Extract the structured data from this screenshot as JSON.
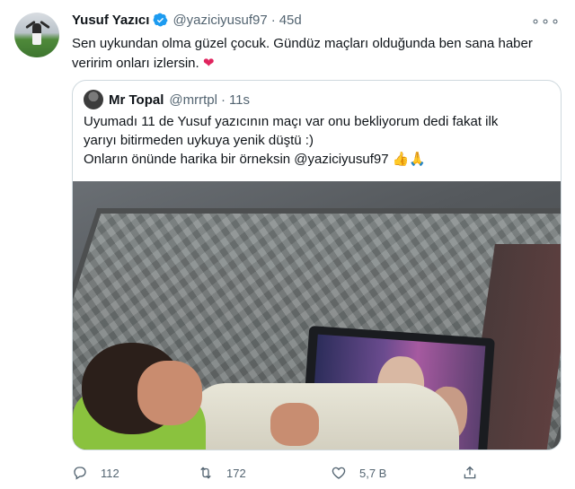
{
  "tweet": {
    "author": {
      "name": "Yusuf Yazıcı",
      "handle": "@yaziciyusuf97",
      "time": "45d",
      "verified": true
    },
    "text": "Sen uykundan olma güzel çocuk. Gündüz maçları olduğunda ben sana haber veririm onları izlersin.",
    "emoji": "❤",
    "more_glyph": "∘∘∘"
  },
  "quote": {
    "author": {
      "name": "Mr Topal",
      "handle": "@mrrtpl",
      "time": "11s"
    },
    "lines": [
      "Uyumadı 11 de Yusuf yazıcının maçı var onu bekliyorum dedi fakat  ilk",
      "yarıyı bitirmeden uykuya yenik düştü :)",
      "Onların önünde harika bir örneksin @yaziciyusuf97 👍🙏"
    ]
  },
  "actions": {
    "replies": "112",
    "retweets": "172",
    "likes": "5,7 B"
  },
  "colors": {
    "verified": "#1d9bf0",
    "muted": "#536471",
    "heart": "#e0245e"
  },
  "icons": [
    "verified-badge-icon",
    "more-icon",
    "reply-icon",
    "retweet-icon",
    "like-icon",
    "share-icon"
  ]
}
